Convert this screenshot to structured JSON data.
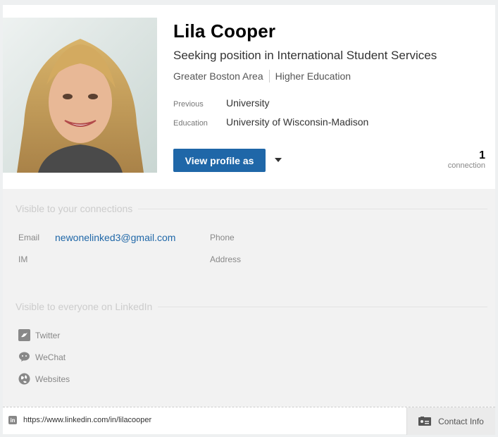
{
  "profile": {
    "name": "Lila Cooper",
    "headline": "Seeking position in International Student Services",
    "location": "Greater Boston Area",
    "industry": "Higher Education",
    "previous_label": "Previous",
    "previous_value": "University",
    "education_label": "Education",
    "education_value": "University of Wisconsin-Madison",
    "view_profile_button": "View profile as",
    "connection_count": "1",
    "connection_label": "connection"
  },
  "contact": {
    "connections_section_title": "Visible to your connections",
    "email_label": "Email",
    "email_value": "newonelinked3@gmail.com",
    "phone_label": "Phone",
    "im_label": "IM",
    "address_label": "Address",
    "public_section_title": "Visible to everyone on LinkedIn",
    "social": [
      {
        "label": "Twitter",
        "icon": "twitter-icon"
      },
      {
        "label": "WeChat",
        "icon": "wechat-icon"
      },
      {
        "label": "Websites",
        "icon": "globe-icon"
      }
    ]
  },
  "footer": {
    "public_url": "https://www.linkedin.com/in/lilacooper",
    "contact_info_button": "Contact Info"
  },
  "colors": {
    "accent": "#1f67a8",
    "muted_text": "#888888",
    "section_background": "#f2f2f2"
  }
}
